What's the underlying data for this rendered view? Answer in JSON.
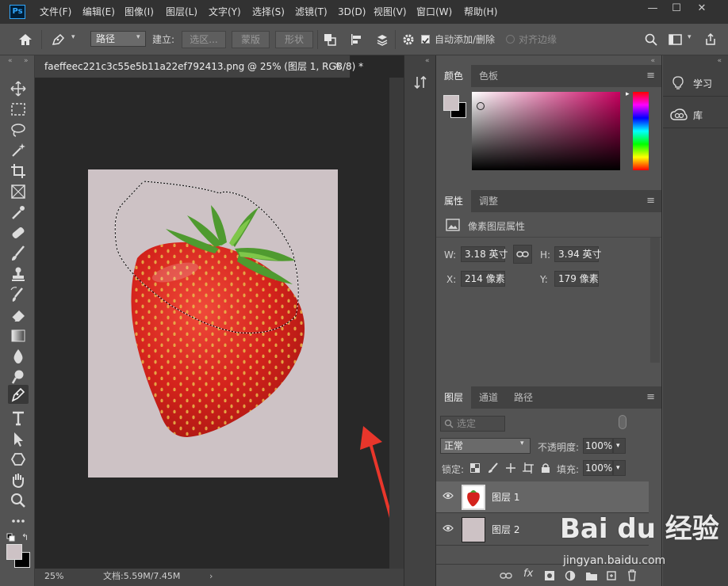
{
  "app": {
    "logo": "Ps"
  },
  "menu": [
    "文件(F)",
    "编辑(E)",
    "图像(I)",
    "图层(L)",
    "文字(Y)",
    "选择(S)",
    "滤镜(T)",
    "3D(D)",
    "视图(V)",
    "窗口(W)",
    "帮助(H)"
  ],
  "window_controls": {
    "minimize": "—",
    "maximize": "☐",
    "close": "✕"
  },
  "options": {
    "mode_value": "路径",
    "make_label": "建立:",
    "selection_btn": "选区...",
    "mask_btn": "蒙版",
    "shape_btn": "形状",
    "auto_add_label": "自动添加/删除",
    "align_edges_label": "对齐边缘"
  },
  "document": {
    "tab_title": "faeffeec221c3c55e5b11a22ef792413.png @ 25% (图层 1, RGB/8) *",
    "close": "×",
    "zoom": "25%",
    "doc_info": "文档:5.59M/7.45M",
    "canvas_color": "#cdc2c5"
  },
  "color_panel": {
    "tabs": [
      "颜色",
      "色板"
    ]
  },
  "properties_panel": {
    "tabs": [
      "属性",
      "调整"
    ],
    "title": "像素图层属性",
    "w_label": "W:",
    "w_value": "3.18 英寸",
    "h_label": "H:",
    "h_value": "3.94 英寸",
    "x_label": "X:",
    "x_value": "214 像素",
    "y_label": "Y:",
    "y_value": "179 像素"
  },
  "layers_panel": {
    "tabs": [
      "图层",
      "通道",
      "路径"
    ],
    "filter_placeholder": "选定",
    "blend_mode": "正常",
    "opacity_label": "不透明度:",
    "opacity_value": "100%",
    "lock_label": "锁定:",
    "fill_label": "填充:",
    "fill_value": "100%",
    "layers": [
      {
        "name": "图层 1"
      },
      {
        "name": "图层 2"
      }
    ],
    "footer_fx": "fx"
  },
  "far_right": {
    "learn": "学习",
    "library": "库"
  },
  "watermark": {
    "brand": "Bai du 经验",
    "url": "jingyan.baidu.com"
  }
}
